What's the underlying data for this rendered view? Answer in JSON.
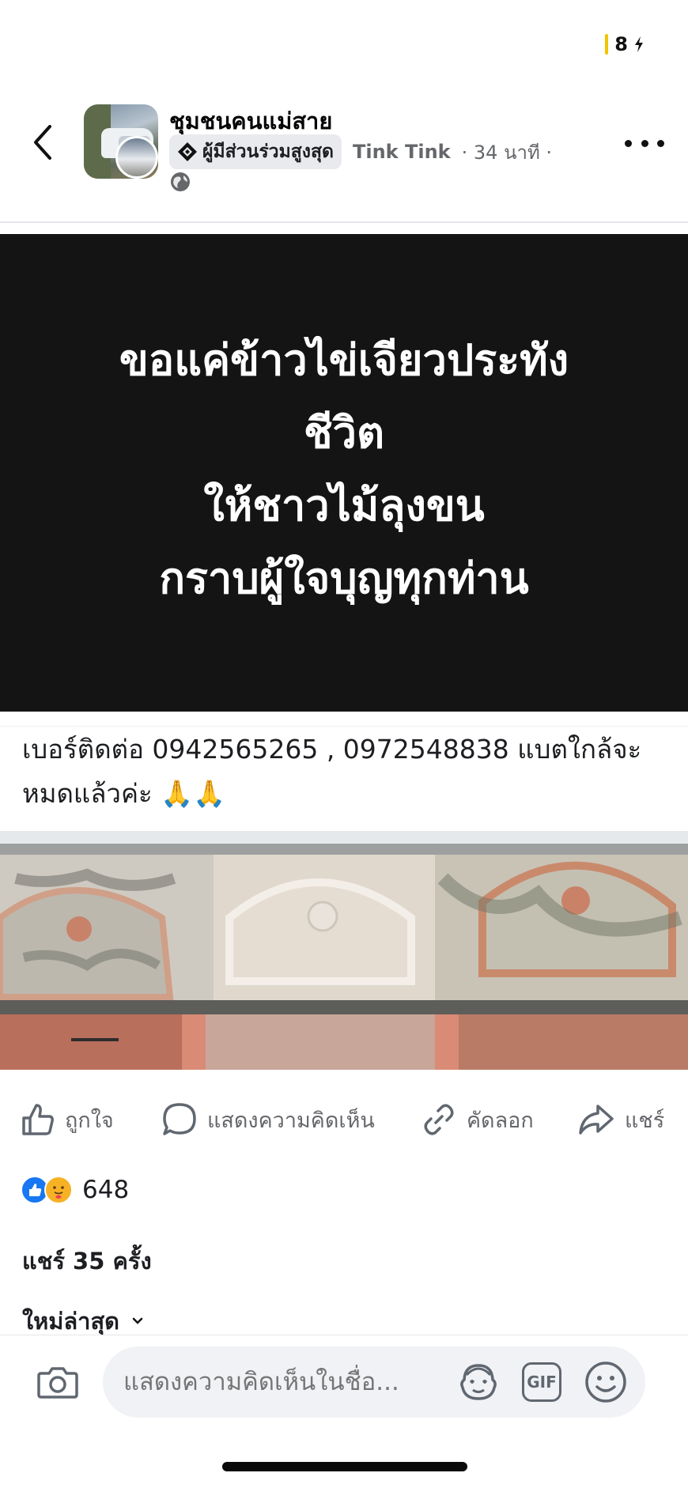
{
  "status_bar": {
    "battery": "8"
  },
  "header": {
    "group_name": "ชุมชนคนแม่สาย",
    "badge": "ผู้มีส่วนร่วมสูงสุด",
    "author": "Tink Tink",
    "time": "· 34 นาที ·"
  },
  "post": {
    "banner_lines": [
      "ขอแค่ข้าวไข่เจียวประทัง",
      "ชีวิต",
      "ให้ชาวไม้ลุงขน",
      "กราบผู้ใจบุญทุกท่าน"
    ],
    "caption": "เบอร์ติดต่อ 0942565265 , 0972548838 แบตใกล้จะหมดแล้วค่ะ 🙏🙏"
  },
  "actions": {
    "like": "ถูกใจ",
    "comment": "แสดงความคิดเห็น",
    "copy": "คัดลอก",
    "share": "แชร์"
  },
  "reactions": {
    "count": "648"
  },
  "shares": {
    "label": "แชร์ 35 ครั้ง"
  },
  "sort": {
    "label": "ใหม่ล่าสุด"
  },
  "composer": {
    "placeholder": "แสดงความคิดเห็นในชื่อ...",
    "gif_label": "GIF"
  }
}
